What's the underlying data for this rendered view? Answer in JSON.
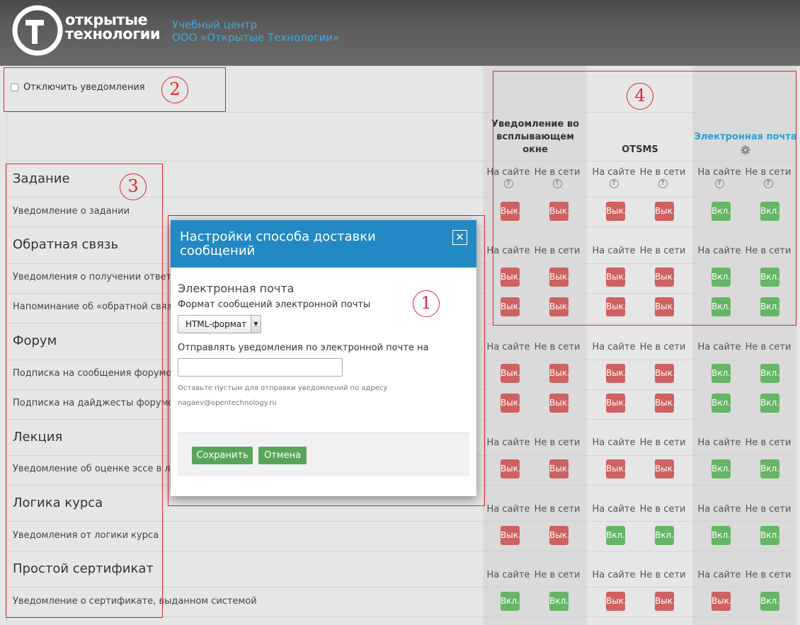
{
  "header": {
    "logo_line1": "открытые",
    "logo_line2": "технологии",
    "brand_line1": "Учебный центр",
    "brand_line2": "ООО «Открытые Технологии»"
  },
  "disable": {
    "label": "Отключить уведомления"
  },
  "processors": [
    {
      "name": "Уведомление во всплывающем окне"
    },
    {
      "name": "OTSMS"
    },
    {
      "name": "Электронная почта"
    }
  ],
  "states": {
    "online": "На сайте",
    "offline": "Не в сети"
  },
  "button_labels": {
    "on": "Вкл.",
    "off": "Вык."
  },
  "components": [
    {
      "title": "Задание",
      "items": [
        {
          "label": "Уведомление о задании",
          "states": [
            "off",
            "off",
            "off",
            "off",
            "on",
            "on"
          ]
        }
      ]
    },
    {
      "title": "Обратная связь",
      "items": [
        {
          "label": "Уведомления о получении ответов в",
          "states": [
            "off",
            "off",
            "off",
            "off",
            "on",
            "on"
          ]
        },
        {
          "label": "Напоминание об «обратной связи»",
          "states": [
            "off",
            "off",
            "off",
            "off",
            "on",
            "on"
          ]
        }
      ]
    },
    {
      "title": "Форум",
      "items": [
        {
          "label": "Подписка на сообщения форумов",
          "states": [
            "off",
            "off",
            "off",
            "off",
            "on",
            "on"
          ]
        },
        {
          "label": "Подписка на дайджесты форумов",
          "states": [
            "off",
            "off",
            "off",
            "off",
            "on",
            "on"
          ]
        }
      ]
    },
    {
      "title": "Лекция",
      "items": [
        {
          "label": "Уведомление об оценке эссе в лекци",
          "states": [
            "off",
            "off",
            "off",
            "off",
            "on",
            "on"
          ]
        }
      ]
    },
    {
      "title": "Логика курса",
      "items": [
        {
          "label": "Уведомления от логики курса",
          "states": [
            "off",
            "off",
            "on",
            "on",
            "on",
            "on"
          ]
        }
      ]
    },
    {
      "title": "Простой сертификат",
      "items": [
        {
          "label": "Уведомление о сертификате, выданном системой",
          "states": [
            "on",
            "on",
            "off",
            "off",
            "off",
            "on"
          ]
        }
      ]
    }
  ],
  "modal": {
    "title": "Настройки способа доставки сообщений",
    "section_title": "Электронная почта",
    "format_label": "Формат сообщений электронной почты",
    "format_value": "HTML-формат",
    "send_label": "Отправлять уведомления по электронной почте на",
    "email_value": "",
    "help_line1": "Оставьте пустым для отправки уведомлений по адресу",
    "help_line2": "nagaev@opentechnology.ru",
    "save_label": "Сохранить",
    "cancel_label": "Отмена"
  },
  "annotations": [
    "1",
    "2",
    "3",
    "4"
  ],
  "colors": {
    "on": "#67b566",
    "off": "#ce6161",
    "accent": "#2389c4",
    "annotation": "#e0262c"
  }
}
